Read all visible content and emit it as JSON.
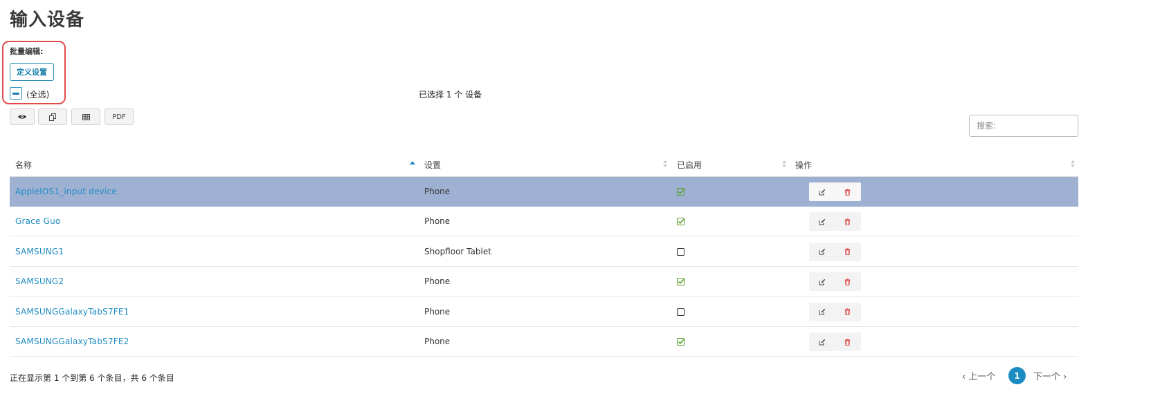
{
  "page": {
    "title": "输入设备"
  },
  "batch_edit": {
    "label": "批量编辑:",
    "define_button": "定义设置",
    "select_all_label": "(全选)",
    "selected_info": "已选择 1 个 设备"
  },
  "toolbar": {
    "view_icon": "eye-icon",
    "copy_icon": "copy-icon",
    "csv_icon": "table-icon",
    "pdf_label": "PDF"
  },
  "search": {
    "placeholder": "搜索:"
  },
  "table": {
    "columns": [
      "名称",
      "设置",
      "已启用",
      "操作"
    ],
    "sort": {
      "column": "名称",
      "direction": "asc"
    },
    "rows": [
      {
        "name": "AppleIOS1_input device",
        "setting": "Phone",
        "enabled": true,
        "selected": true
      },
      {
        "name": "Grace Guo",
        "setting": "Phone",
        "enabled": true,
        "selected": false
      },
      {
        "name": "SAMSUNG1",
        "setting": "Shopfloor Tablet",
        "enabled": false,
        "selected": false
      },
      {
        "name": "SAMSUNG2",
        "setting": "Phone",
        "enabled": true,
        "selected": false
      },
      {
        "name": "SAMSUNGGalaxyTabS7FE1",
        "setting": "Phone",
        "enabled": false,
        "selected": false
      },
      {
        "name": "SAMSUNGGalaxyTabS7FE2",
        "setting": "Phone",
        "enabled": true,
        "selected": false
      }
    ]
  },
  "footer": {
    "info": "正在显示第 1 个到第 6 个条目，共 6 个条目",
    "prev": "‹ 上一个",
    "page": "1",
    "next": "下一个 ›"
  },
  "colors": {
    "accent": "#1b8bc2",
    "link": "#1f8cc4",
    "selected_row": "#9fb1d3",
    "highlight_border": "#e04b4b",
    "check_green": "#5a9e2f",
    "delete_red": "#e05555"
  }
}
